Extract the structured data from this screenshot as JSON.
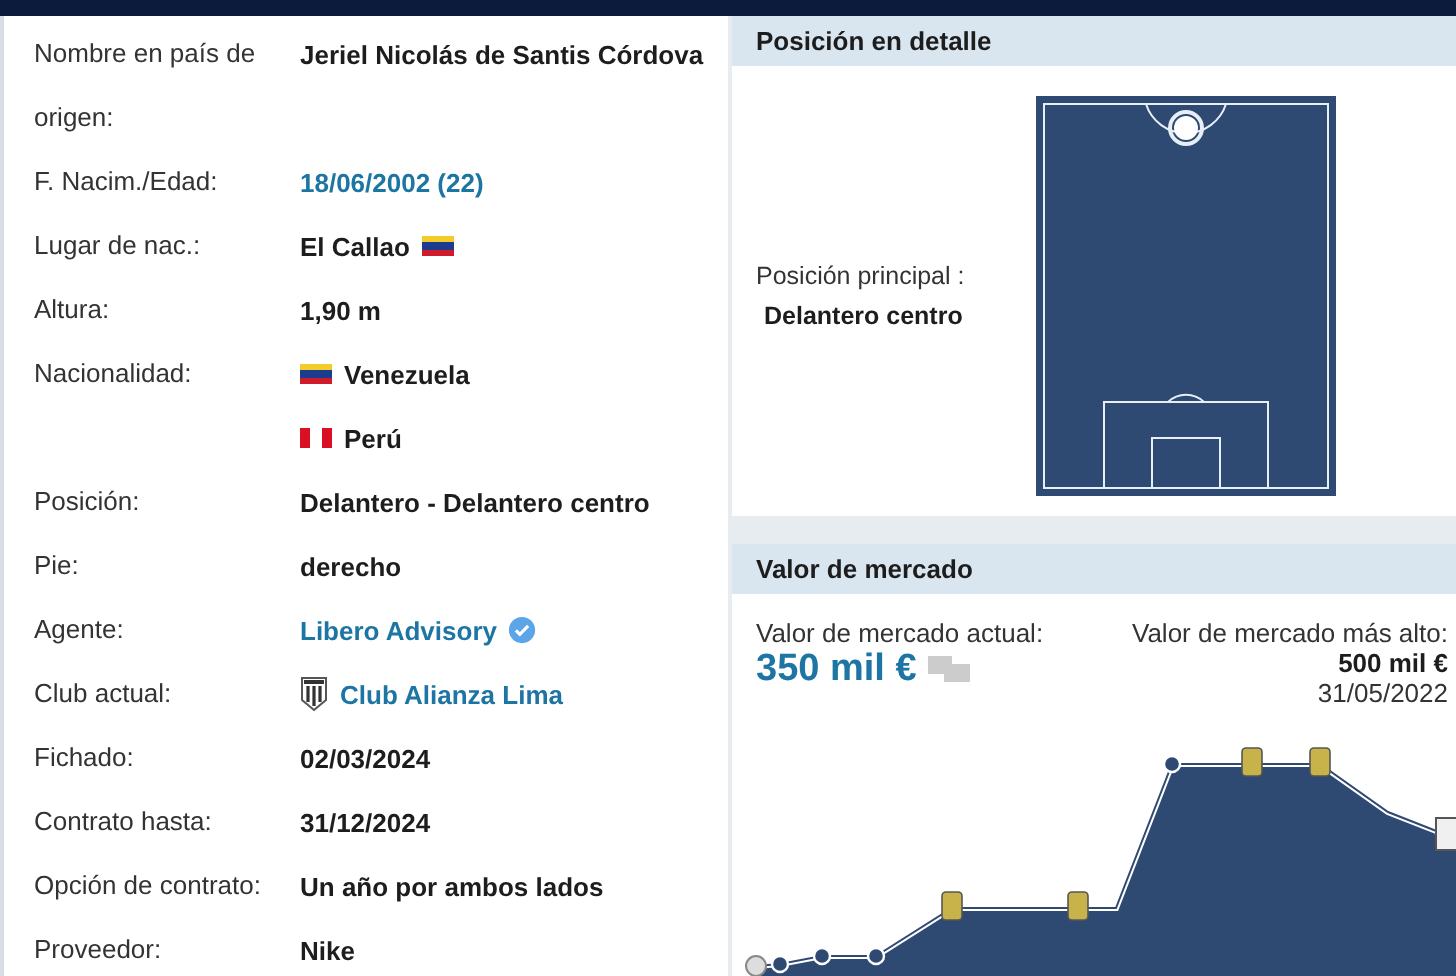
{
  "player_data": {
    "rows": [
      {
        "label": "Nombre en país de origen:",
        "values": [
          [
            {
              "kind": "text",
              "text": "Jeriel Nicolás de Santis Córdova"
            }
          ]
        ]
      },
      {
        "label": "F. Nacim./Edad:",
        "values": [
          [
            {
              "kind": "link",
              "text": "18/06/2002 (22)"
            }
          ]
        ]
      },
      {
        "label": "Lugar de nac.:",
        "values": [
          [
            {
              "kind": "text",
              "text": "El Callao"
            },
            {
              "kind": "flagve"
            }
          ]
        ]
      },
      {
        "label": "Altura:",
        "values": [
          [
            {
              "kind": "text",
              "text": "1,90 m"
            }
          ]
        ]
      },
      {
        "label": "Nacionalidad:",
        "values": [
          [
            {
              "kind": "flagve"
            },
            {
              "kind": "text",
              "text": "Venezuela"
            }
          ],
          [
            {
              "kind": "flagpe"
            },
            {
              "kind": "text",
              "text": "Perú"
            }
          ]
        ]
      },
      {
        "label": "Posición:",
        "values": [
          [
            {
              "kind": "text",
              "text": "Delantero - Delantero centro"
            }
          ]
        ]
      },
      {
        "label": "Pie:",
        "values": [
          [
            {
              "kind": "text",
              "text": "derecho"
            }
          ]
        ]
      },
      {
        "label": "Agente:",
        "values": [
          [
            {
              "kind": "link",
              "text": "Libero Advisory"
            },
            {
              "kind": "verified"
            }
          ]
        ]
      },
      {
        "label": "Club actual:",
        "values": [
          [
            {
              "kind": "crest"
            },
            {
              "kind": "link",
              "text": "Club Alianza Lima"
            }
          ]
        ]
      },
      {
        "label": "Fichado:",
        "values": [
          [
            {
              "kind": "text",
              "text": "02/03/2024"
            }
          ]
        ]
      },
      {
        "label": "Contrato hasta:",
        "values": [
          [
            {
              "kind": "text",
              "text": "31/12/2024"
            }
          ]
        ]
      },
      {
        "label": "Opción de contrato:",
        "values": [
          [
            {
              "kind": "text",
              "text": "Un año por ambos lados"
            }
          ]
        ]
      },
      {
        "label": "Proveedor:",
        "values": [
          [
            {
              "kind": "text",
              "text": "Nike"
            }
          ]
        ]
      }
    ]
  },
  "position_detail": {
    "title": "Posición en detalle",
    "main_label": "Posición principal :",
    "main_value": "Delantero centro"
  },
  "market_value": {
    "title": "Valor de mercado",
    "current_label": "Valor de mercado actual:",
    "current_value": "350 mil €",
    "highest_label": "Valor de mercado más alto:",
    "highest_value": "500 mil €",
    "highest_date": "31/05/2022"
  }
}
